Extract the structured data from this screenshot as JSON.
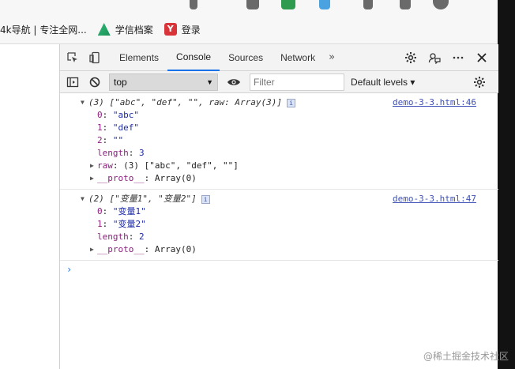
{
  "bookmarks": {
    "item1": "4k导航 | 专注全网...",
    "item2": "学信档案",
    "item3": "登录"
  },
  "devtools": {
    "tabs": [
      "Elements",
      "Console",
      "Sources",
      "Network"
    ],
    "active_tab": "Console",
    "more_tabs": "»"
  },
  "console_bar": {
    "context": "top",
    "filter_placeholder": "Filter",
    "levels": "Default levels ▾"
  },
  "log": {
    "group1": {
      "head": "(3) [\"abc\", \"def\", \"\", raw: Array(3)]",
      "source": "demo-3-3.html:46",
      "lines": [
        {
          "key": "0",
          "val": "\"abc\""
        },
        {
          "key": "1",
          "val": "\"def\""
        },
        {
          "key": "2",
          "val": "\"\""
        },
        {
          "key": "length",
          "val": "3"
        }
      ],
      "raw_key": "raw",
      "raw_val": "(3) [\"abc\", \"def\", \"\"]",
      "proto_key": "__proto__",
      "proto_val": "Array(0)"
    },
    "group2": {
      "head": "(2) [\"变量1\", \"变量2\"]",
      "source": "demo-3-3.html:47",
      "lines": [
        {
          "key": "0",
          "val": "\"变量1\""
        },
        {
          "key": "1",
          "val": "\"变量2\""
        },
        {
          "key": "length",
          "val": "2"
        }
      ],
      "proto_key": "__proto__",
      "proto_val": "Array(0)"
    },
    "prompt": "›"
  },
  "watermark": "@稀土掘金技术社区",
  "colors": {
    "accent": "#1a73e8",
    "key": "#8a1f7d",
    "string": "#1d2ba8",
    "link": "#3f51b5"
  }
}
